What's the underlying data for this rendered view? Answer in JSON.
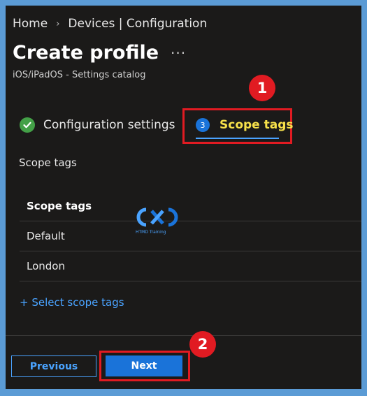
{
  "breadcrumb": {
    "home": "Home",
    "current": "Devices | Configuration"
  },
  "page": {
    "title": "Create profile",
    "more": "···",
    "subtitle": "iOS/iPadOS - Settings catalog"
  },
  "callouts": {
    "first": "1",
    "second": "2"
  },
  "tabs": {
    "configuration": {
      "label": "Configuration settings",
      "status": "complete"
    },
    "scope": {
      "step": "3",
      "label": "Scope tags",
      "active": true
    }
  },
  "scope_section": {
    "label": "Scope tags",
    "table": {
      "header": "Scope tags",
      "rows": [
        "Default",
        "London"
      ]
    },
    "select_link": "+ Select scope tags"
  },
  "watermark": {
    "text": "HTMD Training"
  },
  "footer": {
    "previous": "Previous",
    "next": "Next"
  },
  "colors": {
    "accent": "#4aa3ff",
    "callout": "#e11b22",
    "active_tab_text": "#f7e14a",
    "primary_button": "#1a73d9",
    "success": "#43a047"
  }
}
